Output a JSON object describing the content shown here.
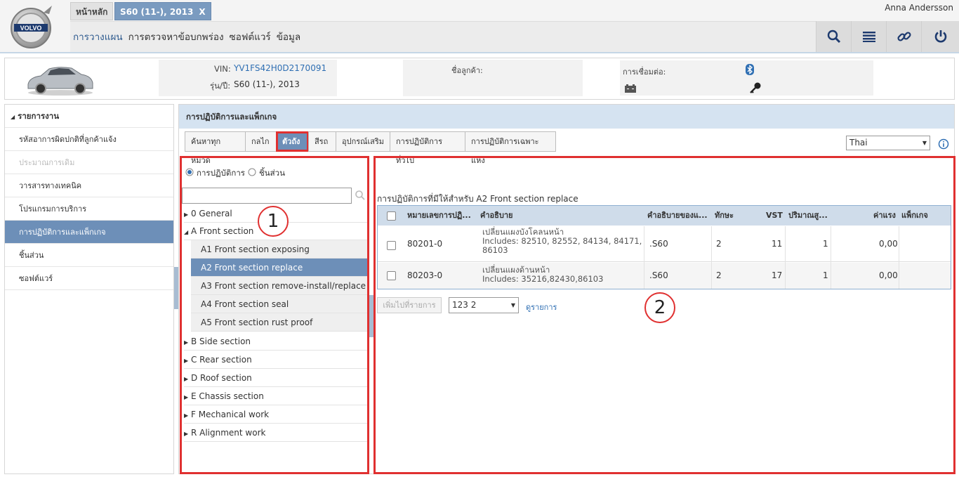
{
  "header": {
    "tabs": [
      {
        "label": "หน้าหลัก"
      },
      {
        "label": "S60 (11-), 2013",
        "close": "X"
      }
    ],
    "nav": [
      "การวางแผน",
      "การตรวจหาข้อบกพร่อง",
      "ซอฟต์แวร์",
      "ข้อมูล"
    ],
    "user": "Anna Andersson",
    "logo_text": "VOLVO",
    "toolbar_icons": [
      "search-icon",
      "list-icon",
      "link-icon",
      "power-icon"
    ]
  },
  "vehicle": {
    "vin_label": "VIN:",
    "vin": "YV1FS42H0D2170091",
    "model_label": "รุ่น/ปี:",
    "model": "S60 (11-), 2013",
    "customer_label": "ชื่อลูกค้า:",
    "connection_label": "การเชื่อมต่อ:"
  },
  "sidebar": {
    "title": "รายการงาน",
    "items": [
      {
        "label": "รหัสอาการผิดปกติที่ลูกค้าแจ้ง",
        "state": "normal"
      },
      {
        "label": "ประมาณการเดิม",
        "state": "disabled"
      },
      {
        "label": "วารสารทางเทคนิค",
        "state": "normal"
      },
      {
        "label": "โปรแกรมการบริการ",
        "state": "normal"
      },
      {
        "label": "การปฏิบัติการและแพ็กเกจ",
        "state": "active"
      },
      {
        "label": "ชิ้นส่วน",
        "state": "normal"
      },
      {
        "label": "ซอฟต์แวร์",
        "state": "normal"
      }
    ]
  },
  "main": {
    "title": "การปฏิบัติการและแพ็กเกจ",
    "filter_tabs": [
      "ค้นหาทุกหมวด",
      "กลไก",
      "ตัวถัง",
      "สีรถ",
      "อุปกรณ์เสริม",
      "การปฏิบัติการทั่วไป",
      "การปฏิบัติการเฉพาะแห่ง"
    ],
    "active_filter": 2,
    "language": "Thai",
    "radio": {
      "operations": "การปฏิบัติการ",
      "parts": "ชิ้นส่วน",
      "selected": "operations"
    },
    "search_placeholder": "",
    "tree": [
      {
        "label": "0 General",
        "expanded": false
      },
      {
        "label": "A Front section",
        "expanded": true,
        "children": [
          {
            "label": "A1 Front section exposing",
            "active": false
          },
          {
            "label": "A2 Front section replace",
            "active": true
          },
          {
            "label": "A3 Front section remove-install/replace",
            "active": false
          },
          {
            "label": "A4 Front section seal",
            "active": false
          },
          {
            "label": "A5 Front section rust proof",
            "active": false
          }
        ]
      },
      {
        "label": "B Side section",
        "expanded": false
      },
      {
        "label": "C Rear section",
        "expanded": false
      },
      {
        "label": "D Roof section",
        "expanded": false
      },
      {
        "label": "E Chassis section",
        "expanded": false
      },
      {
        "label": "F Mechanical work",
        "expanded": false
      },
      {
        "label": "R Alignment work",
        "expanded": false
      }
    ],
    "results_caption": "การปฏิบัติการที่มีให้สำหรับ A2 Front section replace",
    "table": {
      "headers": [
        "หมายเลขการปฏิ...",
        "คำอธิบาย",
        "คำอธิบายของแ...",
        "ทักษะ",
        "VST",
        "ปริมาณสู...",
        "ค่าแรง",
        "แพ็กเกจ"
      ],
      "rows": [
        {
          "number": "80201-0",
          "desc": "เปลี่ยนแผงบังโคลนหน้า",
          "includes": "Includes: 82510, 82552, 84134, 84171, 86103",
          "model": ".S60",
          "skill": "2",
          "vst": "11",
          "qty": "1",
          "labor": "0,00",
          "package": ""
        },
        {
          "number": "80203-0",
          "desc": "เปลี่ยนแผงด้านหน้า",
          "includes": "Includes: 35216,82430,86103",
          "model": ".S60",
          "skill": "2",
          "vst": "17",
          "qty": "1",
          "labor": "0,00",
          "package": ""
        }
      ]
    },
    "add_button": "เพิ่มไปที่รายการ",
    "list_select": "123 2",
    "view_list": "ดูรายการ"
  },
  "annotations": [
    "1",
    "2"
  ]
}
